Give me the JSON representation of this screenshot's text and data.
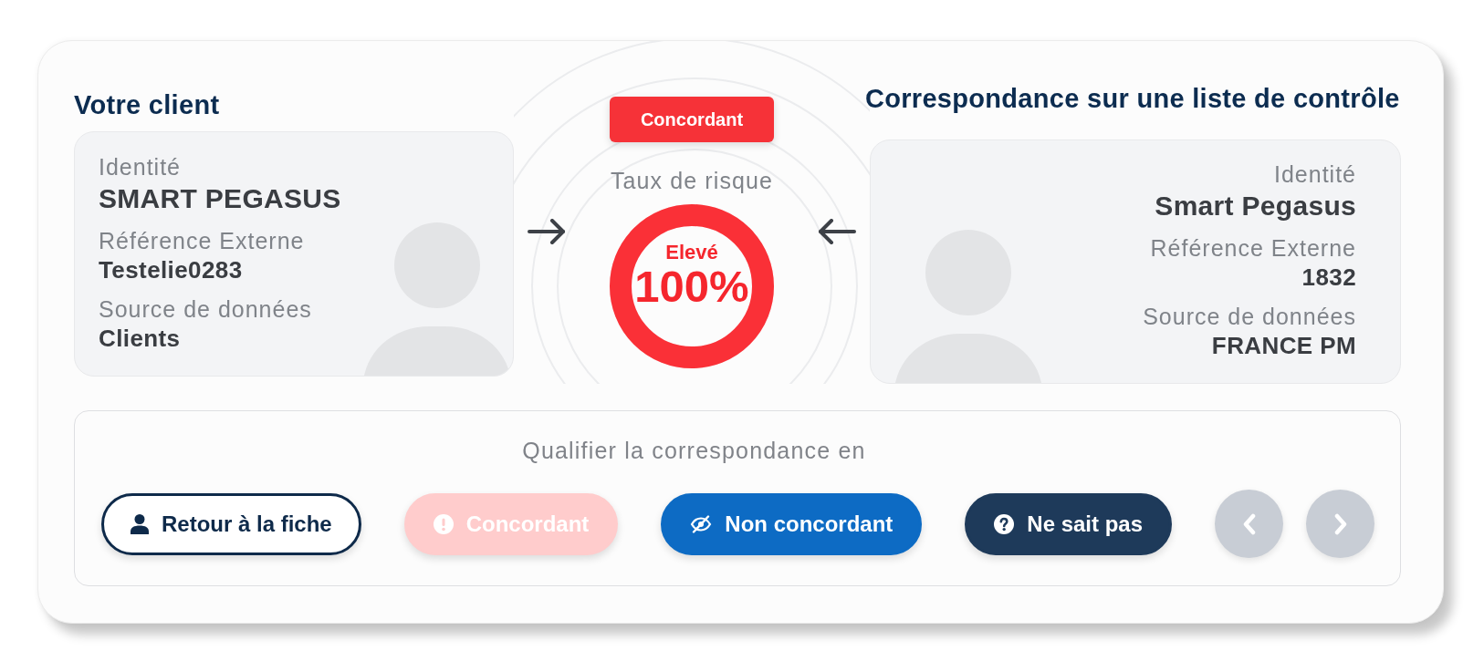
{
  "client": {
    "heading": "Votre client",
    "fields": [
      {
        "label": "Identité",
        "value": "SMART PEGASUS"
      },
      {
        "label": "Référence Externe",
        "value": "Testelie0283"
      },
      {
        "label": "Source de données",
        "value": "Clients"
      }
    ]
  },
  "match": {
    "badge": "Concordant",
    "risk_label": "Taux de risque",
    "risk_level": "Elevé",
    "risk_value": "100%",
    "level": 1
  },
  "watchlist": {
    "heading": "Correspondance sur une liste de contrôle",
    "fields": [
      {
        "label": "Identité",
        "value": "Smart Pegasus"
      },
      {
        "label": "Référence Externe",
        "value": "1832"
      },
      {
        "label": "Source de données",
        "value": "FRANCE PM"
      }
    ]
  },
  "qualify": {
    "prompt": "Qualifier la correspondance en",
    "buttons": [
      {
        "kind": "back",
        "label": "Retour à la fiche",
        "disabled": false
      },
      {
        "kind": "match",
        "label": "Concordant",
        "disabled": true
      },
      {
        "kind": "no_match",
        "label": "Non concordant",
        "disabled": false
      },
      {
        "kind": "unknown",
        "label": "Ne sait pas",
        "disabled": false
      }
    ],
    "nav": [
      {
        "kind": "previous",
        "disabled": true
      },
      {
        "kind": "next",
        "disabled": true
      }
    ]
  }
}
